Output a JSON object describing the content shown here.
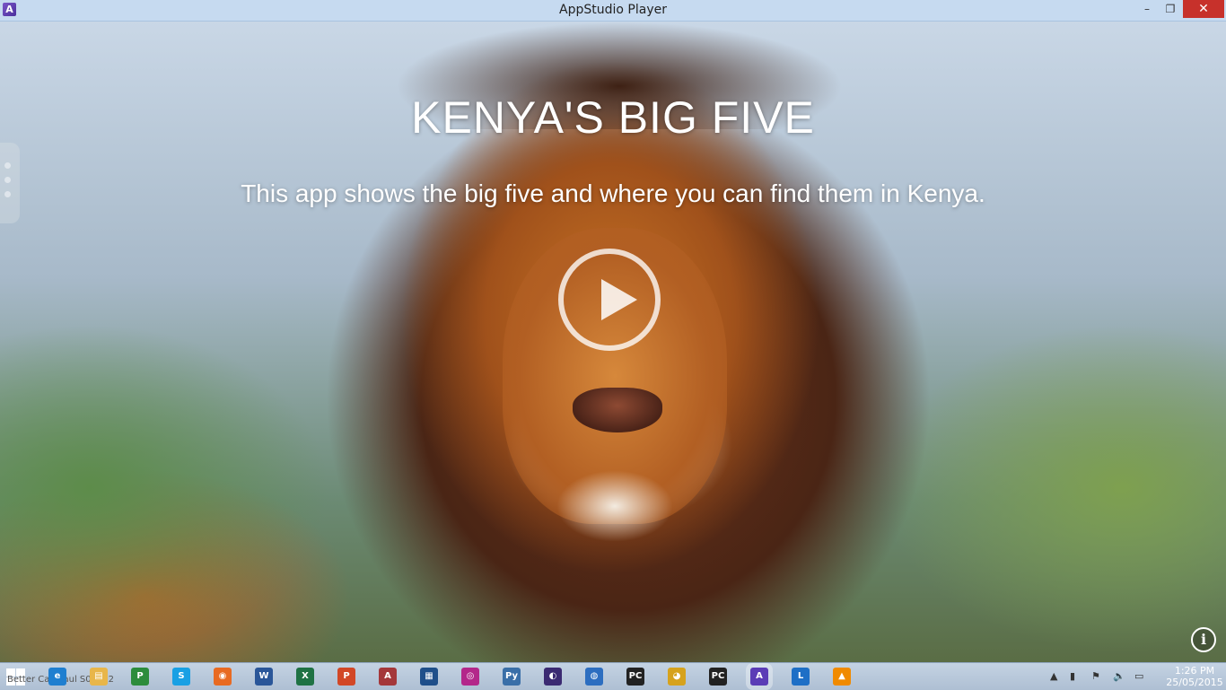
{
  "window": {
    "title": "AppStudio Player",
    "icon_letter": "A",
    "minimize_glyph": "–",
    "restore_glyph": "❐",
    "close_glyph": "✕"
  },
  "main": {
    "title": "KENYA'S BIG FIVE",
    "subtitle": "This app shows the big five and where you can find them in Kenya.",
    "info_glyph": "i"
  },
  "taskbar": {
    "task_label": "Better Call Saul S01E12",
    "icons": [
      {
        "name": "ie-icon",
        "color": "#1f7fd0",
        "glyph": "e"
      },
      {
        "name": "file-explorer-icon",
        "color": "#e8b64a",
        "glyph": "▤"
      },
      {
        "name": "project-icon",
        "color": "#2c8c3c",
        "glyph": "P"
      },
      {
        "name": "skype-icon",
        "color": "#18a0e4",
        "glyph": "S"
      },
      {
        "name": "firefox-icon",
        "color": "#e86a22",
        "glyph": "◉"
      },
      {
        "name": "word-icon",
        "color": "#2a5699",
        "glyph": "W"
      },
      {
        "name": "excel-icon",
        "color": "#1f7244",
        "glyph": "X"
      },
      {
        "name": "powerpoint-icon",
        "color": "#d24726",
        "glyph": "P"
      },
      {
        "name": "access-icon",
        "color": "#a4373a",
        "glyph": "A"
      },
      {
        "name": "window-app-icon",
        "color": "#1f4f8a",
        "glyph": "▦"
      },
      {
        "name": "camera-icon",
        "color": "#b3278a",
        "glyph": "◎"
      },
      {
        "name": "python-icon",
        "color": "#3a6fa8",
        "glyph": "Py"
      },
      {
        "name": "eclipse-icon",
        "color": "#3b2a72",
        "glyph": "◐"
      },
      {
        "name": "globe-icon",
        "color": "#2d6ec0",
        "glyph": "◍"
      },
      {
        "name": "pycharm-icon",
        "color": "#222222",
        "glyph": "PC"
      },
      {
        "name": "chrome-icon",
        "color": "#d6a21d",
        "glyph": "◕"
      },
      {
        "name": "pycharm-icon-2",
        "color": "#222222",
        "glyph": "PC"
      },
      {
        "name": "appstudio-icon",
        "color": "#5b3cb6",
        "glyph": "A"
      },
      {
        "name": "lync-icon",
        "color": "#1e6fc6",
        "glyph": "L"
      },
      {
        "name": "vlc-icon",
        "color": "#f08a00",
        "glyph": "▲"
      }
    ],
    "tray": {
      "show_hidden_glyph": "▲",
      "clock_time": "1:26 PM",
      "clock_date": "25/05/2015"
    }
  }
}
